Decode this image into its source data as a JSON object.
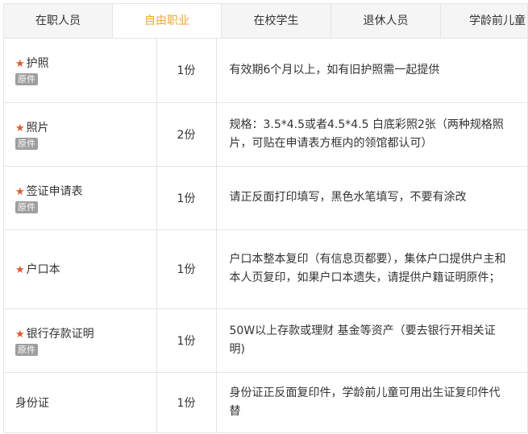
{
  "tabs": [
    "在职人员",
    "自由职业",
    "在校学生",
    "退休人员",
    "学龄前儿童"
  ],
  "active_tab": 1,
  "badge_label": "原件",
  "star": "★",
  "rows": [
    {
      "name": "护照",
      "required": true,
      "original": true,
      "qty": "1份",
      "desc": "有效期6个月以上，如有旧护照需一起提供"
    },
    {
      "name": "照片",
      "required": true,
      "original": true,
      "qty": "2份",
      "desc": "规格：3.5*4.5或者4.5*4.5 白底彩照2张（两种规格照片，可贴在申请表方框内的领馆都认可）"
    },
    {
      "name": "签证申请表",
      "required": true,
      "original": true,
      "qty": "1份",
      "desc": "请正反面打印填写，黑色水笔填写，不要有涂改"
    },
    {
      "name": "户口本",
      "required": true,
      "original": false,
      "qty": "1份",
      "desc": "户口本整本复印（有信息页都要），集体户口提供户主和本人页复印，如果户口本遗失，请提供户籍证明原件；"
    },
    {
      "name": "银行存款证明",
      "required": true,
      "original": true,
      "qty": "1份",
      "desc": "50W以上存款或理财 基金等资产（要去银行开相关证明)"
    },
    {
      "name": "身份证",
      "required": false,
      "original": false,
      "qty": "1份",
      "desc": "身份证正反面复印件，学龄前儿童可用出生证复印件代替"
    }
  ],
  "colors": {
    "active_tab": "#f5a623",
    "star": "#e4572e",
    "badge_bg": "#9e9e9e",
    "border": "#e5e5e5",
    "tab_bg": "#f5f5f5"
  }
}
